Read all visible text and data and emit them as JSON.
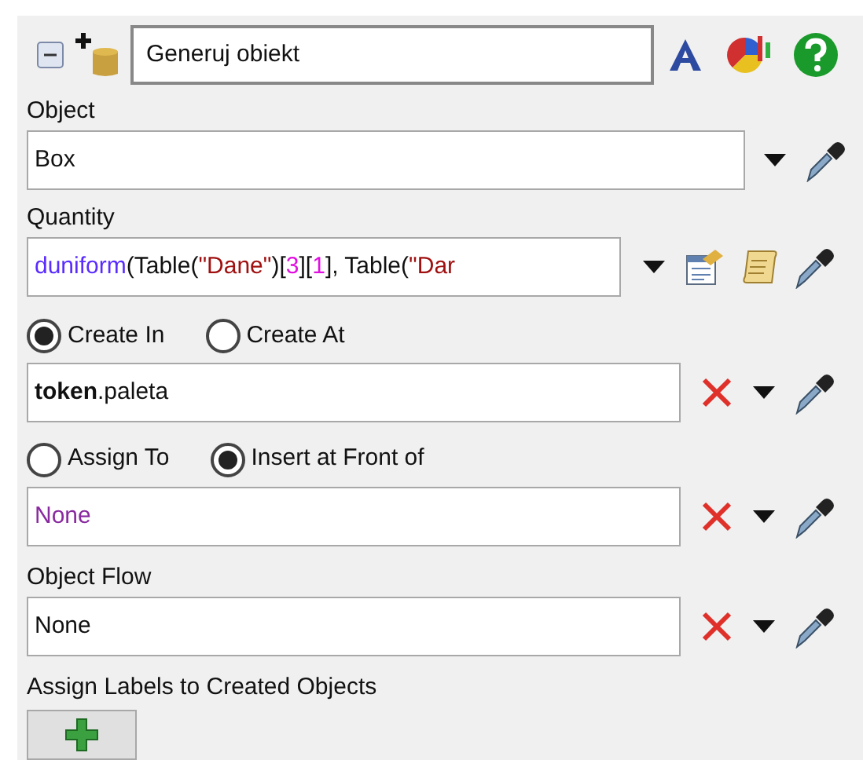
{
  "header": {
    "collapsed": false,
    "name": "Generuj obiekt"
  },
  "object": {
    "label": "Object",
    "value": "Box"
  },
  "quantity": {
    "label": "Quantity",
    "tokens": [
      {
        "kind": "function",
        "text": "duniform"
      },
      {
        "kind": "plain",
        "text": "(Table("
      },
      {
        "kind": "string",
        "text": "\"Dane\""
      },
      {
        "kind": "plain",
        "text": ")["
      },
      {
        "kind": "number",
        "text": "3"
      },
      {
        "kind": "plain",
        "text": "]["
      },
      {
        "kind": "number",
        "text": "1"
      },
      {
        "kind": "plain",
        "text": "], Table("
      },
      {
        "kind": "string",
        "text": "\"Dar"
      }
    ]
  },
  "create_options": [
    {
      "label": "Create In",
      "selected": true
    },
    {
      "label": "Create At",
      "selected": false
    }
  ],
  "create_target": {
    "value": "**token**.paleta",
    "kind": "plain"
  },
  "insert_options": [
    {
      "label": "Assign To",
      "selected": false
    },
    {
      "label": "Insert at Front of",
      "selected": true
    }
  ],
  "insert_target": {
    "value": "None",
    "kind": "keyword"
  },
  "object_flow": {
    "label": "Object Flow",
    "value": "None",
    "kind": "plain"
  },
  "labels_section": {
    "label": "Assign Labels to Created Objects"
  }
}
